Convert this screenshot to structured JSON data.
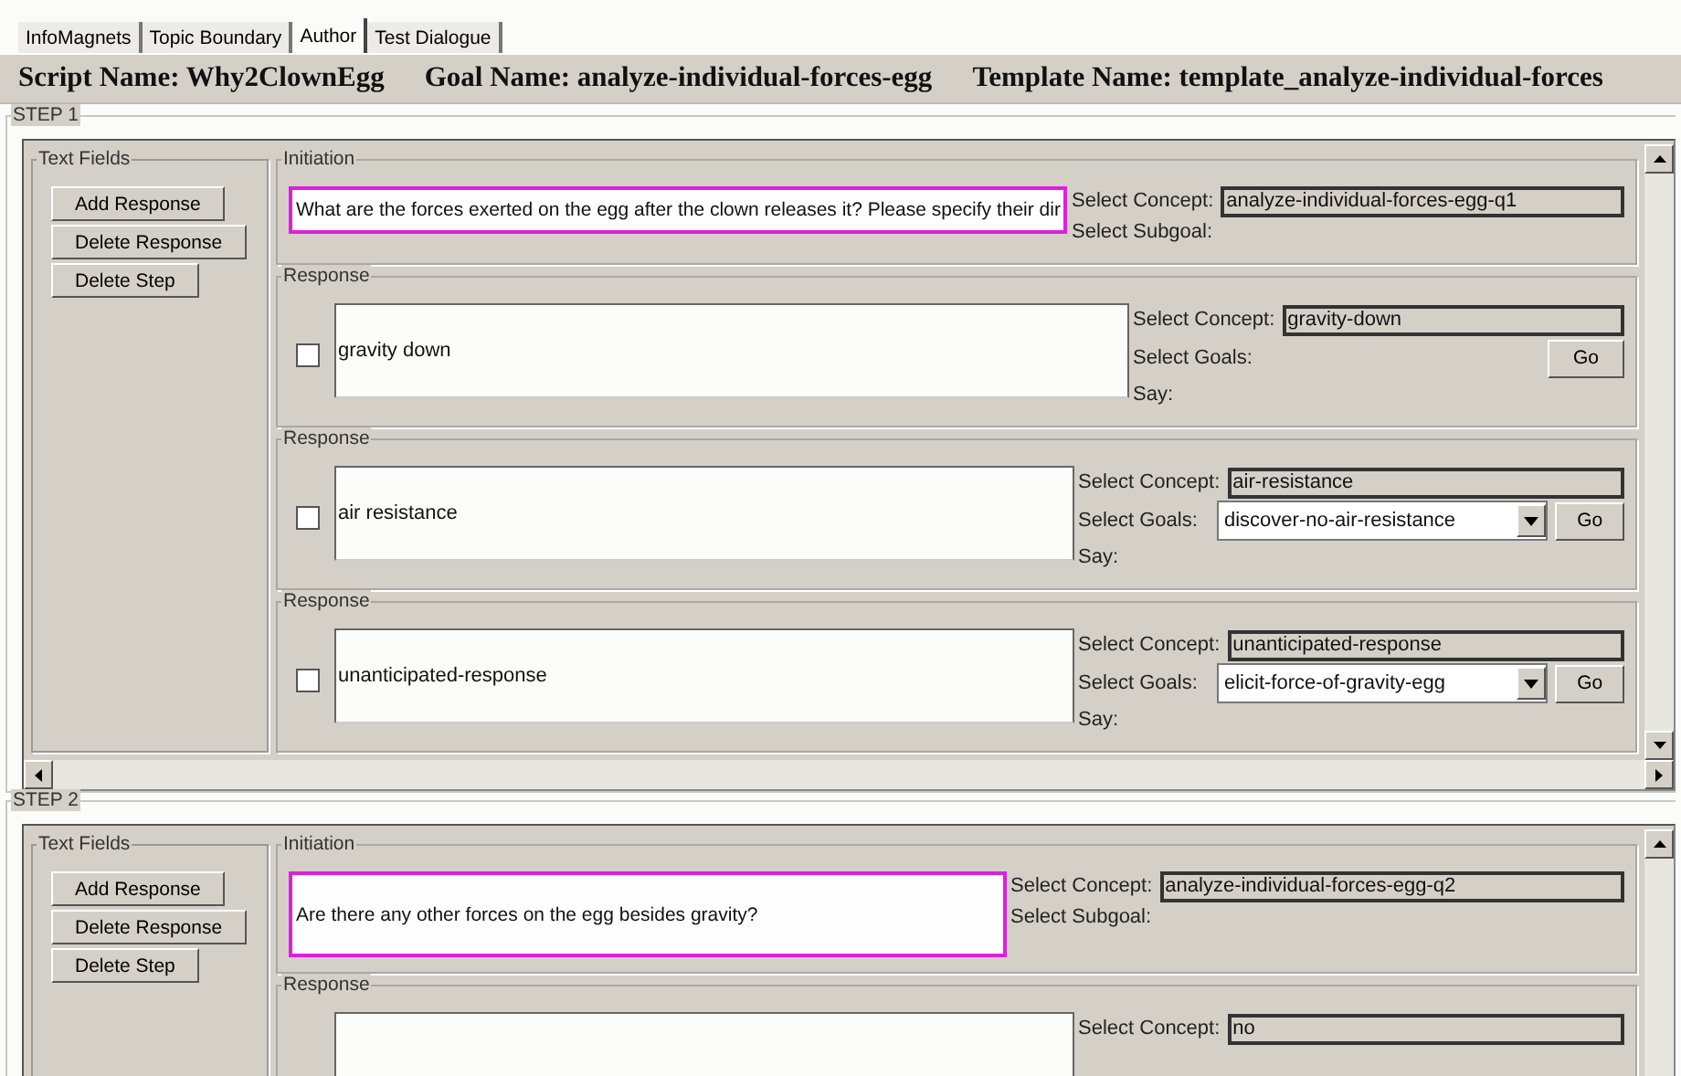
{
  "tabs": [
    {
      "label": "InfoMagnets",
      "selected": false
    },
    {
      "label": "Topic Boundary",
      "selected": false
    },
    {
      "label": "Author",
      "selected": true
    },
    {
      "label": "Test Dialogue",
      "selected": false
    }
  ],
  "header": [
    "Script Name: Why2ClownEgg",
    "Goal Name: analyze-individual-forces-egg",
    "Template Name: template_analyze-individual-forces"
  ],
  "steps": [
    {
      "title": "STEP 1",
      "text_fields": "Text Fields",
      "buttons": [
        "Add Response",
        "Delete Response",
        "Delete Step"
      ],
      "initiation": {
        "legend": "Initiation",
        "question": "What are the forces exerted on the egg after the clown releases it? Please specify their dir",
        "concept_label": "Select Concept:",
        "concept": "analyze-individual-forces-egg-q1",
        "subgoal_label": "Select Subgoal:"
      },
      "responses": [
        {
          "legend": "Response",
          "checked": false,
          "text": "gravity down",
          "concept_label": "Select Concept:",
          "concept": "gravity-down",
          "goals_label": "Select Goals:",
          "go": "Go",
          "say_label": "Say:"
        },
        {
          "legend": "Response",
          "checked": false,
          "text": "air resistance",
          "concept_label": "Select Concept:",
          "concept": "air-resistance",
          "goals_label": "Select Goals:",
          "goal": "discover-no-air-resistance",
          "go": "Go",
          "say_label": "Say:"
        },
        {
          "legend": "Response",
          "checked": false,
          "text": "unanticipated-response",
          "concept_label": "Select Concept:",
          "concept": "unanticipated-response",
          "goals_label": "Select Goals:",
          "goal": "elicit-force-of-gravity-egg",
          "go": "Go",
          "say_label": "Say:"
        }
      ]
    },
    {
      "title": "STEP 2",
      "text_fields": "Text Fields",
      "buttons": [
        "Add Response",
        "Delete Response",
        "Delete Step"
      ],
      "initiation": {
        "legend": "Initiation",
        "question": "Are there any other forces on the egg besides gravity?",
        "concept_label": "Select Concept:",
        "concept": "analyze-individual-forces-egg-q2",
        "subgoal_label": "Select Subgoal:"
      },
      "responses": [
        {
          "legend": "Response",
          "concept_label": "Select Concept:",
          "concept": "no"
        }
      ]
    }
  ]
}
